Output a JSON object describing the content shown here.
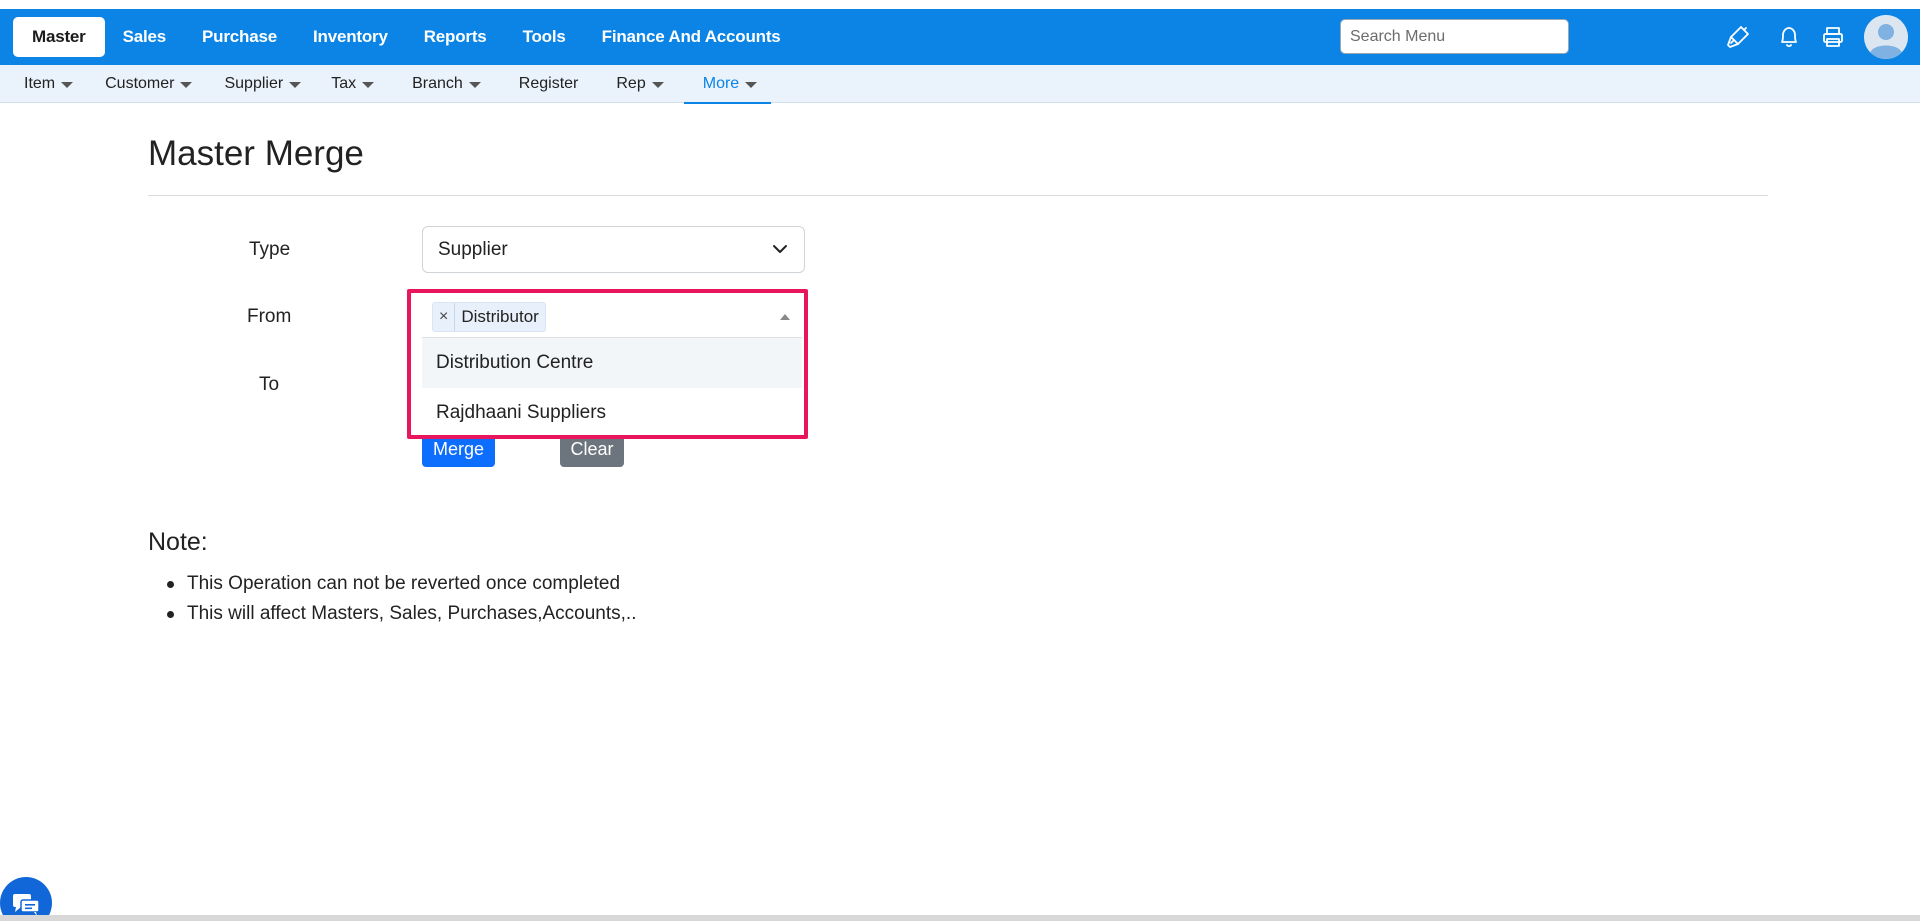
{
  "nav": {
    "items": [
      {
        "label": "Master"
      },
      {
        "label": "Sales"
      },
      {
        "label": "Purchase"
      },
      {
        "label": "Inventory"
      },
      {
        "label": "Reports"
      },
      {
        "label": "Tools"
      },
      {
        "label": "Finance And Accounts"
      }
    ],
    "search_placeholder": "Search Menu",
    "icons": [
      "brush-icon",
      "bell-icon",
      "printer-icon",
      "user-avatar-icon"
    ],
    "color": "#0b84e6"
  },
  "subnav": {
    "items": [
      {
        "label": "Item",
        "dropdown": true
      },
      {
        "label": "Customer",
        "dropdown": true
      },
      {
        "label": "Supplier",
        "dropdown": true
      },
      {
        "label": "Tax",
        "dropdown": true
      },
      {
        "label": "Branch",
        "dropdown": true
      },
      {
        "label": "Register",
        "dropdown": false
      },
      {
        "label": "Rep",
        "dropdown": true
      },
      {
        "label": "More",
        "dropdown": true
      }
    ]
  },
  "page": {
    "title": "Master Merge"
  },
  "form": {
    "type_label": "Type",
    "type_value": "Supplier",
    "from_label": "From",
    "from_tag": "Distributor",
    "from_tag_remove": "×",
    "to_label": "To",
    "options": [
      "Distribution Centre",
      "Rajdhaani Suppliers"
    ],
    "merge_label": "Merge",
    "clear_label": "Clear"
  },
  "note": {
    "title": "Note:",
    "items": [
      "This Operation can not be reverted once completed",
      "This will affect Masters, Sales, Purchases,Accounts,.."
    ]
  },
  "colors": {
    "primary": "#0d6efd",
    "secondary": "#6c757d",
    "highlight": "#e8175d"
  }
}
